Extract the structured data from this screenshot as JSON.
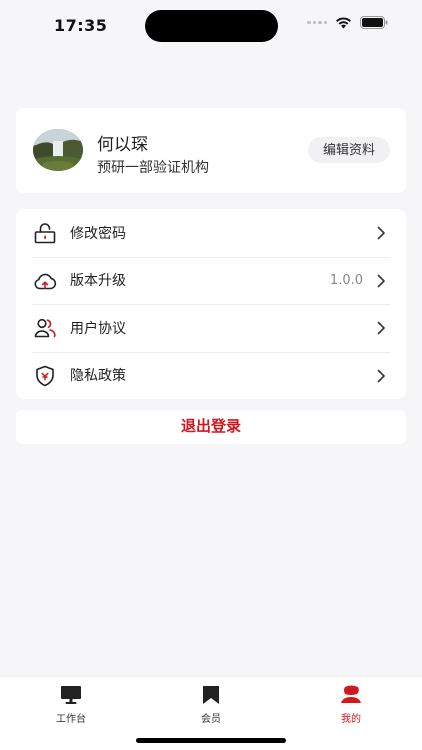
{
  "status_bar": {
    "time": "17:35"
  },
  "profile": {
    "name": "何以琛",
    "organization": "预研一部验证机构",
    "edit_label": "编辑资料"
  },
  "menu": {
    "items": [
      {
        "label": "修改密码",
        "icon": "lock-icon",
        "value": ""
      },
      {
        "label": "版本升级",
        "icon": "cloud-upload-icon",
        "value": "1.0.0"
      },
      {
        "label": "用户协议",
        "icon": "users-icon",
        "value": ""
      },
      {
        "label": "隐私政策",
        "icon": "shield-icon",
        "value": ""
      }
    ]
  },
  "logout_label": "退出登录",
  "tabbar": {
    "items": [
      {
        "label": "工作台",
        "icon": "monitor-icon",
        "active": false
      },
      {
        "label": "会员",
        "icon": "flag-icon",
        "active": false
      },
      {
        "label": "我的",
        "icon": "profile-icon",
        "active": true
      }
    ]
  },
  "colors": {
    "accent": "#d0181e",
    "background": "#f6f6f8"
  }
}
